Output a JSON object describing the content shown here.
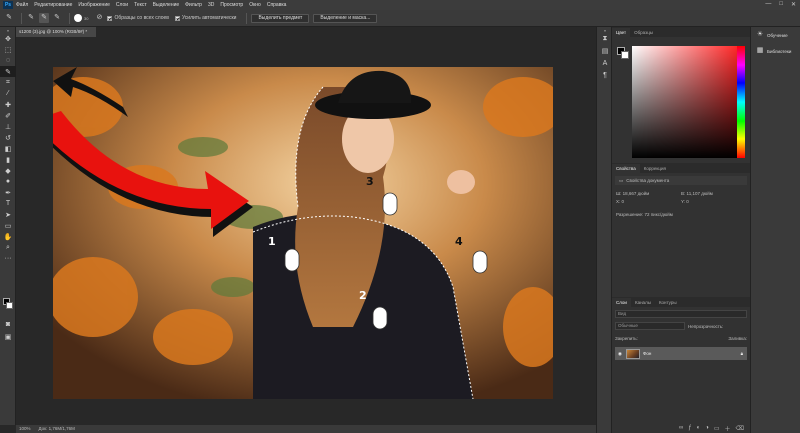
{
  "app": {
    "logo": "Ps"
  },
  "menu": [
    "Файл",
    "Редактирование",
    "Изображение",
    "Слои",
    "Текст",
    "Выделение",
    "Фильтр",
    "3D",
    "Просмотр",
    "Окно",
    "Справка"
  ],
  "window_controls": {
    "minimize": "—",
    "maximize": "□",
    "close": "✕"
  },
  "options_bar": {
    "brush_size": "30",
    "sample_all_layers": "Образцы со всех слоев",
    "auto_enhance": "Усилить автоматически",
    "select_subject": "Выделить предмет",
    "select_and_mask": "Выделение и маска..."
  },
  "document": {
    "tab_title": "s1200 (3).jpg @ 100% (RGB/8#) *"
  },
  "status": {
    "zoom": "100%",
    "doc_size": "Док: 1,76M/1,76M"
  },
  "annotations": {
    "steps": [
      "1",
      "2",
      "3",
      "4"
    ],
    "colors": {
      "arrow": "#e8120e",
      "arrow_shadow": "#111111"
    }
  },
  "color_panel": {
    "tabs": [
      "Цвет",
      "Образцы"
    ]
  },
  "properties_panel": {
    "tabs": [
      "Свойства",
      "Коррекция"
    ],
    "header": "Свойства документа",
    "w_label": "Ш:",
    "w_value": "18,667 дюйм",
    "h_label": "В:",
    "h_value": "11,107 дюйм",
    "x_label": "X:",
    "x_value": "0",
    "y_label": "Y:",
    "y_value": "0",
    "resolution": "Разрешение: 72 пикс/дюйм"
  },
  "layers_panel": {
    "tabs": [
      "Слои",
      "Каналы",
      "Контуры"
    ],
    "kind_placeholder": "Вид",
    "blend_mode": "Обычные",
    "opacity_label": "Непрозрачность:",
    "lock_label": "Закрепить:",
    "fill_label": "Заливка:",
    "layer_name": "Фон"
  },
  "right_column": {
    "learn": "Обучение",
    "libraries": "Библиотеки"
  }
}
